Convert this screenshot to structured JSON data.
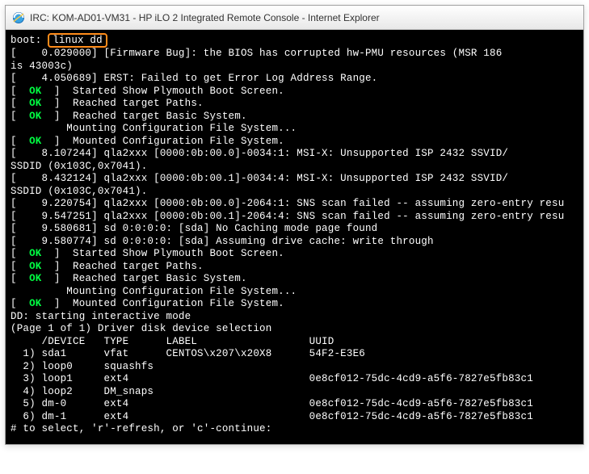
{
  "window": {
    "title": "IRC: KOM-AD01-VM31 - HP iLO 2 Integrated Remote Console - Internet Explorer"
  },
  "boot": {
    "prompt": "boot:",
    "input": "linux dd"
  },
  "lines": [
    "[    0.029000] [Firmware Bug]: the BIOS has corrupted hw-PMU resources (MSR 186",
    "is 43003c)",
    "[    4.050689] ERST: Failed to get Error Log Address Range.",
    "[  OK  ] Started Show Plymouth Boot Screen.",
    "[  OK  ] Reached target Paths.",
    "[  OK  ] Reached target Basic System.",
    "         Mounting Configuration File System...",
    "[  OK  ] Mounted Configuration File System.",
    "[    8.107244] qla2xxx [0000:0b:00.0]-0034:1: MSI-X: Unsupported ISP 2432 SSVID/",
    "SSDID (0x103C,0x7041).",
    "[    8.432124] qla2xxx [0000:0b:00.1]-0034:4: MSI-X: Unsupported ISP 2432 SSVID/",
    "SSDID (0x103C,0x7041).",
    "[    9.220754] qla2xxx [0000:0b:00.0]-2064:1: SNS scan failed -- assuming zero-entry resu",
    "[    9.547251] qla2xxx [0000:0b:00.1]-2064:4: SNS scan failed -- assuming zero-entry resu",
    "[    9.580681] sd 0:0:0:0: [sda] No Caching mode page found",
    "[    9.580774] sd 0:0:0:0: [sda] Assuming drive cache: write through",
    "[  OK  ] Started Show Plymouth Boot Screen.",
    "[  OK  ] Reached target Paths.",
    "[  OK  ] Reached target Basic System.",
    "         Mounting Configuration File System...",
    "[  OK  ] Mounted Configuration File System.",
    "DD: starting interactive mode",
    "",
    "(Page 1 of 1) Driver disk device selection",
    "     /DEVICE   TYPE      LABEL                  UUID",
    "  1) sda1      vfat      CENTOS\\x207\\x20X8      54F2-E3E6",
    "  2) loop0     squashfs",
    "  3) loop1     ext4                             0e8cf012-75dc-4cd9-a5f6-7827e5fb83c1",
    "  4) loop2     DM_snaps",
    "  5) dm-0      ext4                             0e8cf012-75dc-4cd9-a5f6-7827e5fb83c1",
    "  6) dm-1      ext4                             0e8cf012-75dc-4cd9-a5f6-7827e5fb83c1",
    "# to select, 'r'-refresh, or 'c'-continue:"
  ],
  "ok_lines": [
    3,
    4,
    5,
    7,
    16,
    17,
    18,
    20
  ]
}
